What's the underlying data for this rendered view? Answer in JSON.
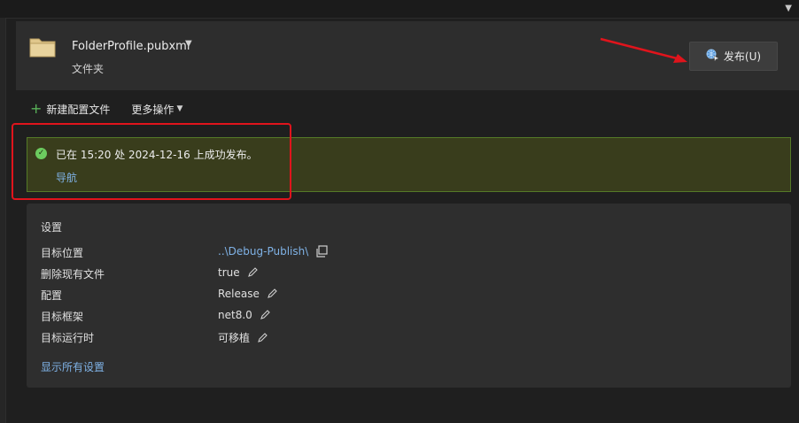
{
  "profile": {
    "name": "FolderProfile.pubxml",
    "type": "文件夹",
    "publish_label": "发布(U)"
  },
  "toolbar": {
    "new_profile": "新建配置文件",
    "more_actions": "更多操作"
  },
  "banner": {
    "message": "已在 15:20 处 2024-12-16 上成功发布。",
    "link": "导航"
  },
  "settings": {
    "title": "设置",
    "rows": [
      {
        "key": "目标位置",
        "value": "..\\Debug-Publish\\"
      },
      {
        "key": "删除现有文件",
        "value": "true"
      },
      {
        "key": "配置",
        "value": "Release"
      },
      {
        "key": "目标框架",
        "value": "net8.0"
      },
      {
        "key": "目标运行时",
        "value": "可移植"
      }
    ],
    "show_all": "显示所有设置"
  },
  "icons": [
    "folder-icon",
    "globe-publish-icon",
    "plus-icon",
    "check-icon",
    "copy-icon",
    "edit-icon",
    "chevron-down-icon"
  ],
  "colors": {
    "accent_link": "#7fb2e6",
    "success": "#6ccb5f",
    "banner_bg": "#393d1c",
    "annotation_red": "#e0141c"
  }
}
